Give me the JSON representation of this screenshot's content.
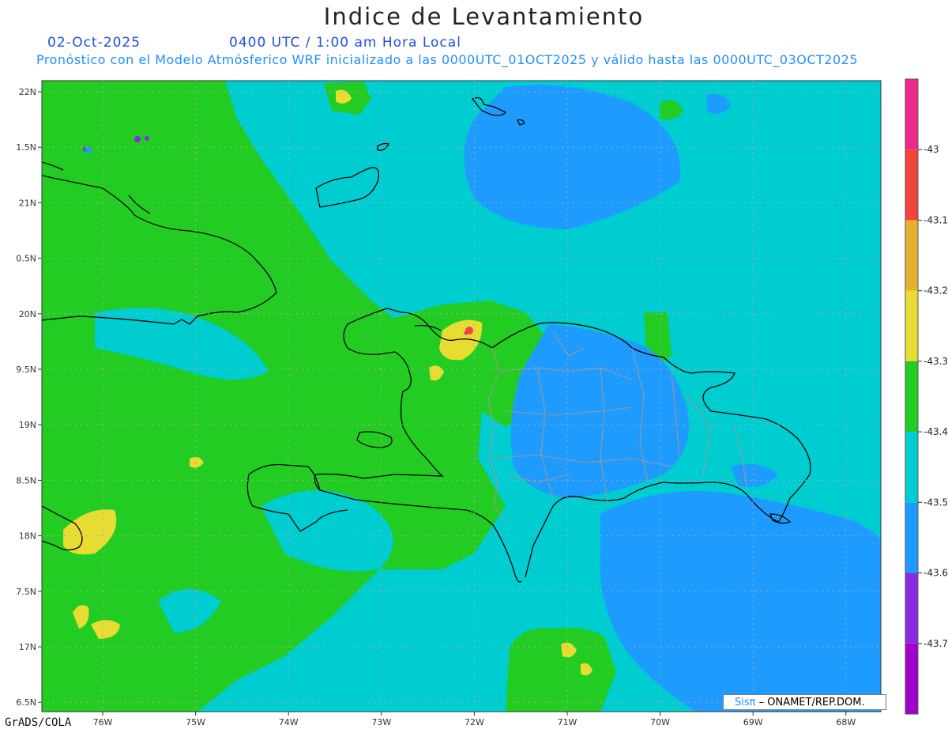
{
  "title": "Indice de Levantamiento",
  "date": "02-Oct-2025",
  "time": "0400 UTC / 1:00 am Hora Local",
  "subtitle": "Pronóstico con el Modelo Atmósferico WRF inicializado a las 0000UTC_01OCT2025 y válido hasta las  0000UTC_03OCT2025",
  "footer": "GrADS/COLA",
  "credit": {
    "logo": "Sisπ",
    "text": "– ONAMET/REP.DOM."
  },
  "colors": {
    "ocean": "#00cdd0",
    "green": "#22cc22",
    "blue": "#1e9bff",
    "yellow": "#e6dc32",
    "orange": "#e6af2d",
    "red": "#f0463c",
    "magenta": "#f0288c",
    "purple": "#8a2be2",
    "violet": "#a000c8",
    "coast": "#000000",
    "provinces": "#999999"
  },
  "map": {
    "lon_labels": [
      "76W",
      "75W",
      "74W",
      "73W",
      "72W",
      "71W",
      "70W",
      "69W",
      "68W"
    ],
    "lat_labels": [
      "22N",
      "1.5N",
      "21N",
      "0.5N",
      "20N",
      "9.5N",
      "19N",
      "8.5N",
      "18N",
      "7.5N",
      "17N",
      "6.5N"
    ]
  },
  "legend": {
    "labels": [
      "-43",
      "-43.1",
      "-43.2",
      "-43.3",
      "-43.4",
      "-43.5",
      "-43.6",
      "-43.7"
    ],
    "colors": [
      "#f0288c",
      "#f0463c",
      "#e6af2d",
      "#e6dc32",
      "#22cc22",
      "#00cdd0",
      "#1e9bff",
      "#8a2be2",
      "#a000c8"
    ]
  }
}
